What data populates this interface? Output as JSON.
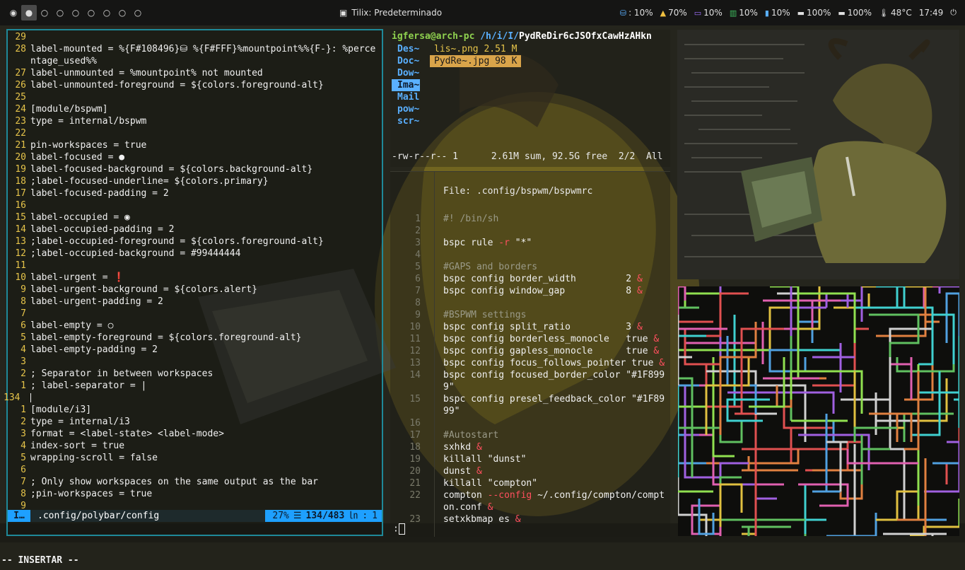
{
  "topbar": {
    "workspaces": [
      "◉",
      "●",
      "○",
      "○",
      "○",
      "○",
      "○",
      "○",
      "○"
    ],
    "focused_workspace": 2,
    "window_title_icon": "window-icon",
    "window_title": "Tilix: Predeterminado",
    "modules": [
      {
        "icon": "disk-icon",
        "glyph": "⛁",
        "text": ": 10%"
      },
      {
        "icon": "filesystem-icon",
        "glyph": "▲",
        "text": "70%"
      },
      {
        "icon": "cpu-icon",
        "glyph": "▭",
        "text": "10%"
      },
      {
        "icon": "memory-icon",
        "glyph": "▥",
        "text": "10%"
      },
      {
        "icon": "battery-icon",
        "glyph": "▮",
        "text": "10%"
      },
      {
        "icon": "battery-full-icon",
        "glyph": "▬",
        "text": "100%"
      },
      {
        "icon": "battery2-icon",
        "glyph": "▬",
        "text": "100%"
      },
      {
        "icon": "thermometer-icon",
        "glyph": "🌡",
        "text": "48°C"
      },
      {
        "icon": "clock-icon",
        "glyph": "",
        "text": "17:49"
      },
      {
        "icon": "power-icon",
        "glyph": "⏻",
        "text": ""
      }
    ],
    "module_colors": [
      "#5ab0ff",
      "#f0c040",
      "#a070ff",
      "#40c060",
      "#5ab0ff",
      "#e0e0e0",
      "#e0e0e0",
      "#e0e0e0",
      "#e0e0e0",
      "#e0e0e0"
    ]
  },
  "vim": {
    "lines": [
      {
        "n": "29",
        "t": ""
      },
      {
        "n": "28",
        "t": "label-mounted = %{F#108496}⛁ %{F#FFF}%mountpoint%%{F-}: %perce"
      },
      {
        "n": "",
        "t": "ntage_used%%"
      },
      {
        "n": "27",
        "t": "label-unmounted = %mountpoint% not mounted"
      },
      {
        "n": "26",
        "t": "label-unmounted-foreground = ${colors.foreground-alt}"
      },
      {
        "n": "25",
        "t": ""
      },
      {
        "n": "24",
        "t": "[module/bspwm]"
      },
      {
        "n": "23",
        "t": "type = internal/bspwm"
      },
      {
        "n": "22",
        "t": ""
      },
      {
        "n": "21",
        "t": "pin-workspaces = true"
      },
      {
        "n": "20",
        "t": "label-focused = ●"
      },
      {
        "n": "19",
        "t": "label-focused-background = ${colors.background-alt}"
      },
      {
        "n": "18",
        "t": ";label-focused-underline= ${colors.primary}"
      },
      {
        "n": "17",
        "t": "label-focused-padding = 2"
      },
      {
        "n": "16",
        "t": ""
      },
      {
        "n": "15",
        "t": "label-occupied = ◉"
      },
      {
        "n": "14",
        "t": "label-occupied-padding = 2"
      },
      {
        "n": "13",
        "t": ";label-occupied-foreground = ${colors.foreground-alt}"
      },
      {
        "n": "12",
        "t": ";label-occupied-background = #99444444"
      },
      {
        "n": "11",
        "t": ""
      },
      {
        "n": "10",
        "t": "label-urgent = ❗"
      },
      {
        "n": "9",
        "t": "label-urgent-background = ${colors.alert}"
      },
      {
        "n": "8",
        "t": "label-urgent-padding = 2"
      },
      {
        "n": "7",
        "t": ""
      },
      {
        "n": "6",
        "t": "label-empty = ○"
      },
      {
        "n": "5",
        "t": "label-empty-foreground = ${colors.foreground-alt}"
      },
      {
        "n": "4",
        "t": "label-empty-padding = 2"
      },
      {
        "n": "3",
        "t": ""
      },
      {
        "n": "2",
        "t": "; Separator in between workspaces"
      },
      {
        "n": "1",
        "t": "; label-separator = |"
      },
      {
        "n": "134",
        "t": ""
      },
      {
        "n": "1",
        "t": "[module/i3]"
      },
      {
        "n": "2",
        "t": "type = internal/i3"
      },
      {
        "n": "3",
        "t": "format = <label-state> <label-mode>"
      },
      {
        "n": "4",
        "t": "index-sort = true"
      },
      {
        "n": "5",
        "t": "wrapping-scroll = false"
      },
      {
        "n": "6",
        "t": ""
      },
      {
        "n": "7",
        "t": "; Only show workspaces on the same output as the bar"
      },
      {
        "n": "8",
        "t": ";pin-workspaces = true"
      },
      {
        "n": "9",
        "t": ""
      }
    ],
    "status": {
      "mode": "I…",
      "file": ".config/polybar/config",
      "percent": "27%",
      "menu_glyph": "☰",
      "position": "134/483",
      "ln_glyph": "㏑",
      "col": ":",
      "colnum": "1"
    },
    "cmdline": "-- INSERTAR --"
  },
  "ranger": {
    "user": "igfersa@arch-pc",
    "path": "/h/i/I/",
    "current_file": "PydReDir6cJSOfxCawHzAHkn",
    "dirs": [
      "Des~",
      "Doc~",
      "Dow~",
      "Ima~",
      "Mail",
      "pow~",
      "scr~"
    ],
    "selected_dir": 3,
    "files": [
      {
        "name": "lis~.png",
        "size": "2.51 M"
      },
      {
        "name": "PydRe~.jpg",
        "size": "98 K"
      }
    ],
    "selected_file": 1,
    "status": "-rw-r--r-- 1      2.61M sum, 92.5G free  2/2  All"
  },
  "bspwmrc": {
    "file_label": "File: .config/bspwm/bspwmrc",
    "lines": [
      {
        "n": "1",
        "parts": [
          [
            "cmt",
            "#! /bin/sh"
          ]
        ]
      },
      {
        "n": "2",
        "parts": []
      },
      {
        "n": "3",
        "parts": [
          [
            "str",
            "bspc rule "
          ],
          [
            "flag",
            "-r"
          ],
          [
            "str",
            " \"*\""
          ]
        ]
      },
      {
        "n": "4",
        "parts": []
      },
      {
        "n": "5",
        "parts": [
          [
            "cmt",
            "#GAPS and borders"
          ]
        ]
      },
      {
        "n": "6",
        "parts": [
          [
            "str",
            "bspc config border_width         2 "
          ],
          [
            "amp",
            "&"
          ]
        ]
      },
      {
        "n": "7",
        "parts": [
          [
            "str",
            "bspc config window_gap           8 "
          ],
          [
            "amp",
            "&"
          ]
        ]
      },
      {
        "n": "8",
        "parts": []
      },
      {
        "n": "9",
        "parts": [
          [
            "cmt",
            "#BSPWM settings"
          ]
        ]
      },
      {
        "n": "10",
        "parts": [
          [
            "str",
            "bspc config split_ratio          3 "
          ],
          [
            "amp",
            "&"
          ]
        ]
      },
      {
        "n": "11",
        "parts": [
          [
            "str",
            "bspc config borderless_monocle   true "
          ],
          [
            "amp",
            "&"
          ]
        ]
      },
      {
        "n": "12",
        "parts": [
          [
            "str",
            "bspc config gapless_monocle      true "
          ],
          [
            "amp",
            "&"
          ]
        ]
      },
      {
        "n": "13",
        "parts": [
          [
            "str",
            "bspc config focus_follows_pointer true "
          ],
          [
            "amp",
            "&"
          ]
        ]
      },
      {
        "n": "14",
        "parts": [
          [
            "str",
            "bspc config focused_border_color \"#1F899"
          ]
        ]
      },
      {
        "n": "",
        "parts": [
          [
            "str",
            "9\""
          ]
        ]
      },
      {
        "n": "15",
        "parts": [
          [
            "str",
            "bspc config presel_feedback_color \"#1F89"
          ]
        ]
      },
      {
        "n": "",
        "parts": [
          [
            "str",
            "99\""
          ]
        ]
      },
      {
        "n": "16",
        "parts": []
      },
      {
        "n": "17",
        "parts": [
          [
            "cmt",
            "#Autostart"
          ]
        ]
      },
      {
        "n": "18",
        "parts": [
          [
            "str",
            "sxhkd "
          ],
          [
            "amp",
            "&"
          ]
        ]
      },
      {
        "n": "19",
        "parts": [
          [
            "str",
            "killall \"dunst\""
          ]
        ]
      },
      {
        "n": "20",
        "parts": [
          [
            "str",
            "dunst "
          ],
          [
            "amp",
            "&"
          ]
        ]
      },
      {
        "n": "21",
        "parts": [
          [
            "str",
            "killall \"compton\""
          ]
        ]
      },
      {
        "n": "22",
        "parts": [
          [
            "str",
            "compton "
          ],
          [
            "flag",
            "--config"
          ],
          [
            "str",
            " ~/.config/compton/compt"
          ]
        ]
      },
      {
        "n": "",
        "parts": [
          [
            "str",
            "on.conf "
          ],
          [
            "amp",
            "&"
          ]
        ]
      },
      {
        "n": "23",
        "parts": [
          [
            "str",
            "setxkbmap es "
          ],
          [
            "amp",
            "&"
          ]
        ]
      }
    ],
    "prompt": ":"
  },
  "colors": {
    "accent": "#1f8999",
    "statusline": "#1ea0ff",
    "ranger_dir": "#5ab0ff",
    "ranger_selected_file": "#d9a44a",
    "line_number": "#e6c44a",
    "ampersand": "#ff4f5e"
  }
}
